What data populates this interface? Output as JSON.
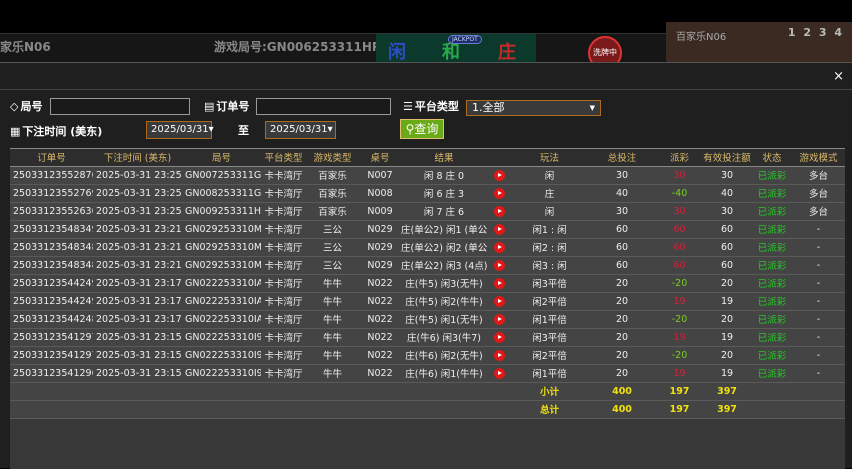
{
  "background": {
    "table_name": "家乐N06",
    "game_round": "游戏局号:GN006253311HP",
    "road": [
      "闲",
      "和",
      "庄"
    ],
    "jackpot": "JACKPOT",
    "shuffle": "洗牌中",
    "cam_name": "百家乐N06",
    "cam_nums": "1 2 3 4"
  },
  "modal": {
    "close": "×"
  },
  "filters": {
    "round_label": "局号",
    "round_value": "",
    "order_label": "订单号",
    "order_value": "",
    "platform_label": "平台类型",
    "platform_value": "1.全部",
    "time_label": "下注时间 (美东)",
    "date_from": "2025/03/31",
    "date_to": "2025/03/31",
    "to_label": "至",
    "query_label": "查询"
  },
  "colors": {
    "accent": "#6aaa16",
    "header_text": "#d9b86a",
    "payout_positive": "#d0213a",
    "payout_negative": "#7acc1e",
    "status": "#22cc22",
    "totals": "#f1e20b"
  },
  "table": {
    "headers": [
      "订单号",
      "下注时间 (美东)",
      "局号",
      "平台类型",
      "游戏类型",
      "桌号",
      "结果",
      "",
      "玩法",
      "总投注",
      "派彩",
      "有效投注额",
      "状态",
      "游戏模式"
    ],
    "rows": [
      [
        "250331235528761",
        "2025-03-31 23:25:45",
        "GN007253311GK",
        "卡卡湾厅",
        "百家乐",
        "N007",
        "闲 8 庄 0",
        "闲",
        "30",
        "30",
        "30",
        "已派彩",
        "多台"
      ],
      [
        "250331235527695",
        "2025-03-31 23:25:39",
        "GN008253311GL",
        "卡卡湾厅",
        "百家乐",
        "N008",
        "闲 6 庄 3",
        "庄",
        "40",
        "-40",
        "40",
        "已派彩",
        "多台"
      ],
      [
        "250331235526363",
        "2025-03-31 23:25:32",
        "GN009253311HI",
        "卡卡湾厅",
        "百家乐",
        "N009",
        "闲 7 庄 6",
        "闲",
        "30",
        "30",
        "30",
        "已派彩",
        "多台"
      ],
      [
        "250331235483490",
        "2025-03-31 23:21:41",
        "GN029253310MI",
        "卡卡湾厅",
        "三公",
        "N029",
        "庄(单公2) 闲1 (单公5)",
        "闲1 : 闲",
        "60",
        "60",
        "60",
        "已派彩",
        "-"
      ],
      [
        "250331235483489",
        "2025-03-31 23:21:41",
        "GN029253310MI",
        "卡卡湾厅",
        "三公",
        "N029",
        "庄(单公2) 闲2 (单公7)",
        "闲2 : 闲",
        "60",
        "60",
        "60",
        "已派彩",
        "-"
      ],
      [
        "250331235483488",
        "2025-03-31 23:21:41",
        "GN029253310MI",
        "卡卡湾厅",
        "三公",
        "N029",
        "庄(单公2) 闲3 (4点)",
        "闲3 : 闲",
        "60",
        "60",
        "60",
        "已派彩",
        "-"
      ],
      [
        "250331235442491",
        "2025-03-31 23:17:42",
        "GN022253310IA",
        "卡卡湾厅",
        "牛牛",
        "N022",
        "庄(牛5) 闲3(无牛)",
        "闲3平倍",
        "20",
        "-20",
        "20",
        "已派彩",
        "-"
      ],
      [
        "250331235442490",
        "2025-03-31 23:17:42",
        "GN022253310IA",
        "卡卡湾厅",
        "牛牛",
        "N022",
        "庄(牛5) 闲2(牛牛)",
        "闲2平倍",
        "20",
        "19",
        "19",
        "已派彩",
        "-"
      ],
      [
        "250331235442489",
        "2025-03-31 23:17:42",
        "GN022253310IA",
        "卡卡湾厅",
        "牛牛",
        "N022",
        "庄(牛5) 闲1(无牛)",
        "闲1平倍",
        "20",
        "-20",
        "20",
        "已派彩",
        "-"
      ],
      [
        "250331235412972",
        "2025-03-31 23:15:07",
        "GN022253310I9",
        "卡卡湾厅",
        "牛牛",
        "N022",
        "庄(牛6) 闲3(牛7)",
        "闲3平倍",
        "20",
        "19",
        "19",
        "已派彩",
        "-"
      ],
      [
        "250331235412970",
        "2025-03-31 23:15:07",
        "GN022253310I9",
        "卡卡湾厅",
        "牛牛",
        "N022",
        "庄(牛6) 闲2(无牛)",
        "闲2平倍",
        "20",
        "-20",
        "20",
        "已派彩",
        "-"
      ],
      [
        "250331235412969",
        "2025-03-31 23:15:07",
        "GN022253310I9",
        "卡卡湾厅",
        "牛牛",
        "N022",
        "庄(牛6) 闲1(牛牛)",
        "闲1平倍",
        "20",
        "19",
        "19",
        "已派彩",
        "-"
      ]
    ],
    "subtotal": {
      "label": "小计",
      "total_bet": "400",
      "payout": "197",
      "valid_bet": "397"
    },
    "total": {
      "label": "总计",
      "total_bet": "400",
      "payout": "197",
      "valid_bet": "397"
    }
  }
}
